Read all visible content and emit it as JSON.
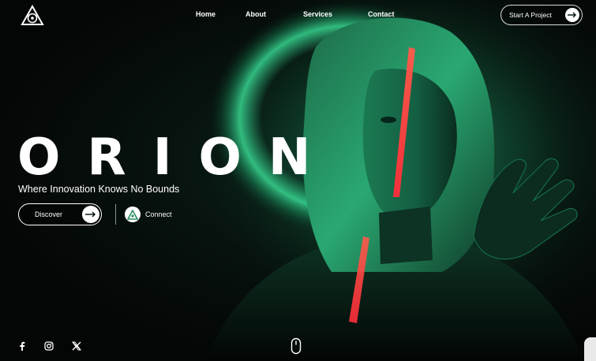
{
  "header": {
    "logo_icon": "triangle-logo-icon",
    "nav": [
      {
        "label": "Home"
      },
      {
        "label": "About"
      },
      {
        "label": "Services"
      },
      {
        "label": "Contact"
      }
    ],
    "cta": {
      "label": "Start A Project",
      "icon": "arrow-right-icon"
    }
  },
  "hero": {
    "title": "ORION",
    "subtitle": "Where Innovation Knows No Bounds",
    "discover": {
      "label": "Discover",
      "icon": "arrow-right-icon"
    },
    "connect": {
      "label": "Connect",
      "icon": "triangle-logo-icon"
    }
  },
  "footer": {
    "social": [
      {
        "icon": "facebook-icon"
      },
      {
        "icon": "instagram-icon"
      },
      {
        "icon": "x-twitter-icon"
      }
    ],
    "scroll_icon": "mouse-scroll-icon"
  },
  "colors": {
    "background": "#050807",
    "accent_green": "#2fd08a",
    "laser_red": "#ff3b3b",
    "text": "#ffffff"
  }
}
